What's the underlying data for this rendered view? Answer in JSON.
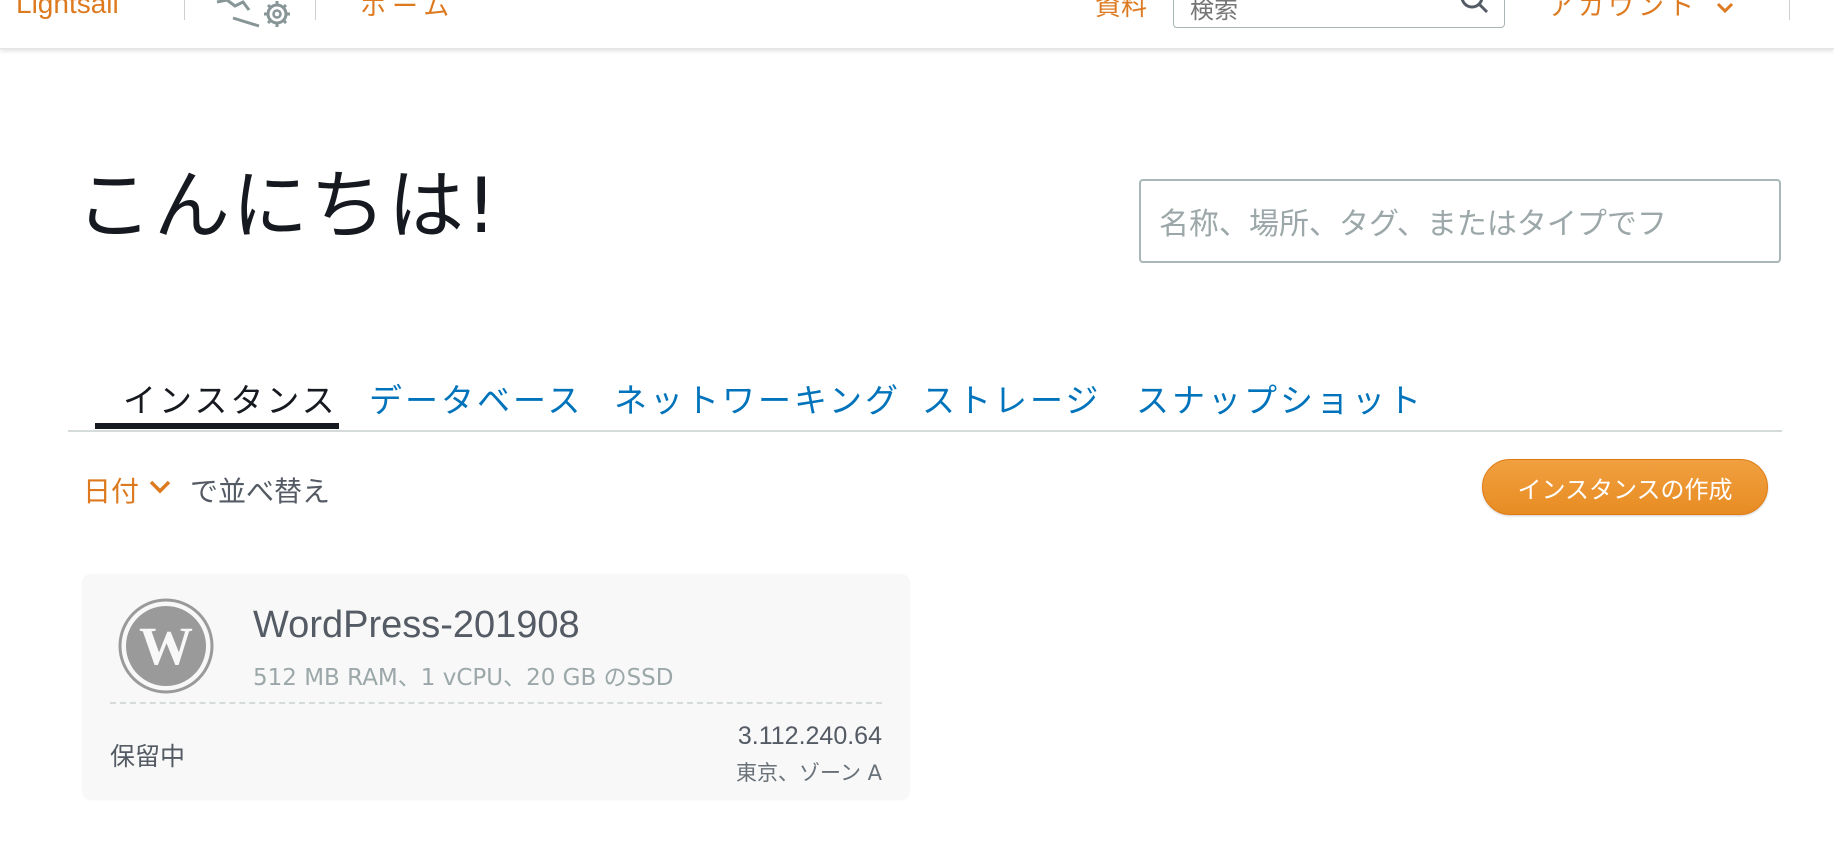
{
  "nav": {
    "logo": "Lightsail",
    "home": "ホーム",
    "docs": "資料",
    "search_placeholder": "検索",
    "account": "アカウント"
  },
  "greeting": "こんにちは!",
  "main_search": {
    "placeholder": "名称、場所、タグ、またはタイプでフ"
  },
  "tabs": [
    {
      "label": "インスタンス",
      "active": true
    },
    {
      "label": "データベース",
      "active": false
    },
    {
      "label": "ネットワーキング",
      "active": false
    },
    {
      "label": "ストレージ",
      "active": false
    },
    {
      "label": "スナップショット",
      "active": false
    }
  ],
  "sort": {
    "field": "日付",
    "suffix": "で並べ替え"
  },
  "create_button": "インスタンスの作成",
  "instance": {
    "icon": "wordpress-icon",
    "name": "WordPress-201908",
    "spec": "512 MB RAM、1 vCPU、20 GB のSSD",
    "status": "保留中",
    "ip": "3.112.240.64",
    "zone": "東京、ゾーン A"
  },
  "colors": {
    "accent": "#dd7a1f",
    "link": "#0073bb",
    "button": "#eb8f28"
  }
}
